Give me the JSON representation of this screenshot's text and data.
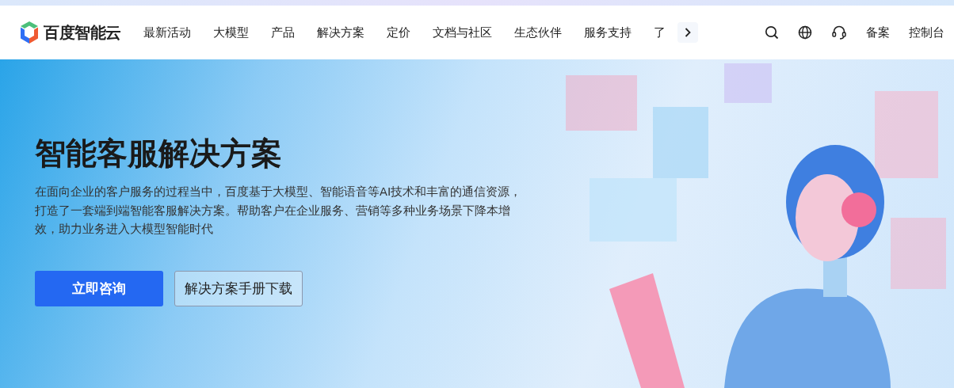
{
  "brand": {
    "name": "百度智能云"
  },
  "nav": [
    {
      "label": "最新活动"
    },
    {
      "label": "大模型"
    },
    {
      "label": "产品"
    },
    {
      "label": "解决方案"
    },
    {
      "label": "定价"
    },
    {
      "label": "文档与社区"
    },
    {
      "label": "生态伙伴"
    },
    {
      "label": "服务支持"
    },
    {
      "label": "了"
    }
  ],
  "nav_right": [
    {
      "label": "备案"
    },
    {
      "label": "控制台"
    }
  ],
  "hero": {
    "title": "智能客服解决方案",
    "description": "在面向企业的客户服务的过程当中，百度基于大模型、智能语音等AI技术和丰富的通信资源，打造了一套端到端智能客服解决方案。帮助客户在企业服务、营销等多种业务场景下降本增效，助力业务进入大模型智能时代",
    "buttons": [
      {
        "label": "立即咨询",
        "kind": "primary"
      },
      {
        "label": "解决方案手册下载",
        "kind": "secondary"
      }
    ]
  }
}
